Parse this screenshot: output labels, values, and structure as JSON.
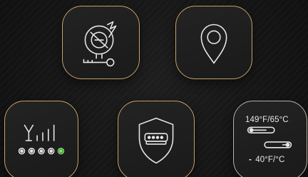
{
  "tiles": [
    {
      "id": "motor",
      "icon": "engine-motor-icon"
    },
    {
      "id": "location",
      "icon": "location-pin-icon"
    },
    {
      "id": "signal",
      "icon": "signal-strength-icon"
    },
    {
      "id": "shield",
      "icon": "shield-connector-icon"
    },
    {
      "id": "temperature",
      "icon": "temperature-range-icon"
    }
  ],
  "temperature": {
    "high_label": "149°F/65°C",
    "low_dash": "-",
    "low_label": "40°F/°C"
  },
  "colors": {
    "background": "#151515",
    "icon_stroke": "#e6e6e6",
    "tile_border_gray": "#b9b4ab",
    "tile_border_warm": "#c9a36d",
    "led_green": "#7ee06a"
  }
}
